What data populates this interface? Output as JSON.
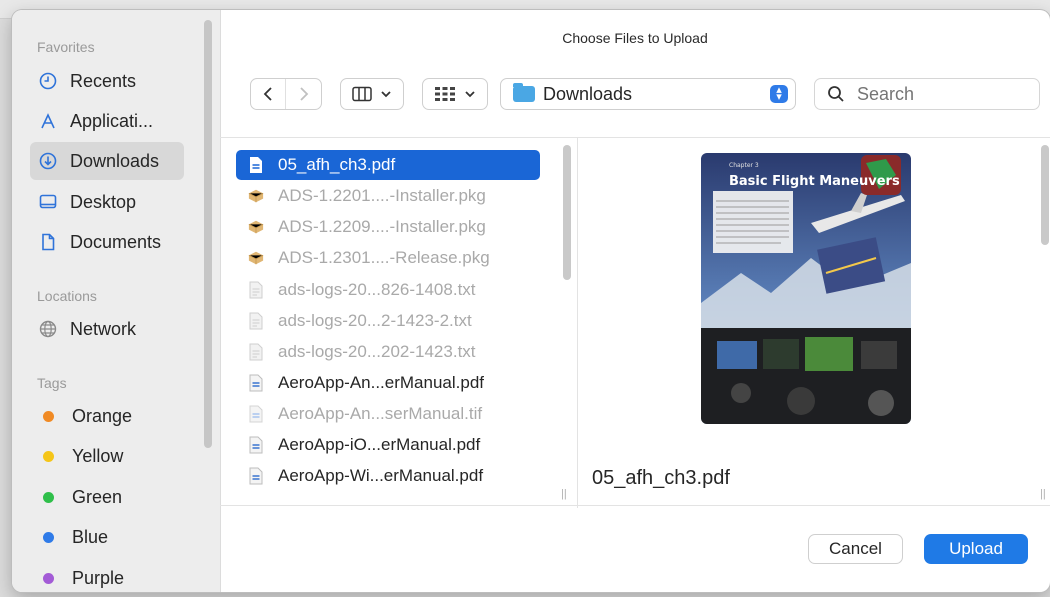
{
  "dialog": {
    "title": "Choose Files to Upload"
  },
  "sidebar": {
    "favorites_header": "Favorites",
    "favorites": [
      {
        "label": "Recents",
        "icon": "clock-icon"
      },
      {
        "label": "Applicati...",
        "icon": "applications-icon"
      },
      {
        "label": "Downloads",
        "icon": "download-icon",
        "active": true
      },
      {
        "label": "Desktop",
        "icon": "desktop-icon"
      },
      {
        "label": "Documents",
        "icon": "document-icon"
      }
    ],
    "locations_header": "Locations",
    "locations": [
      {
        "label": "Network",
        "icon": "globe-icon"
      }
    ],
    "tags_header": "Tags",
    "tags": [
      {
        "label": "Orange",
        "color": "#f08a24"
      },
      {
        "label": "Yellow",
        "color": "#f5c518"
      },
      {
        "label": "Green",
        "color": "#2fbf4a"
      },
      {
        "label": "Blue",
        "color": "#2f7be8"
      },
      {
        "label": "Purple",
        "color": "#a35bd6"
      }
    ]
  },
  "toolbar": {
    "location": "Downloads",
    "search_placeholder": "Search"
  },
  "files": [
    {
      "name": "05_afh_ch3.pdf",
      "type": "pdf",
      "selected": true,
      "dimmed": false
    },
    {
      "name": "ADS-1.2201....-Installer.pkg",
      "type": "pkg",
      "selected": false,
      "dimmed": true
    },
    {
      "name": "ADS-1.2209....-Installer.pkg",
      "type": "pkg",
      "selected": false,
      "dimmed": true
    },
    {
      "name": "ADS-1.2301....-Release.pkg",
      "type": "pkg",
      "selected": false,
      "dimmed": true
    },
    {
      "name": "ads-logs-20...826-1408.txt",
      "type": "txt",
      "selected": false,
      "dimmed": true
    },
    {
      "name": "ads-logs-20...2-1423-2.txt",
      "type": "txt",
      "selected": false,
      "dimmed": true
    },
    {
      "name": "ads-logs-20...202-1423.txt",
      "type": "txt",
      "selected": false,
      "dimmed": true
    },
    {
      "name": "AeroApp-An...erManual.pdf",
      "type": "pdf",
      "selected": false,
      "dimmed": false
    },
    {
      "name": "AeroApp-An...serManual.tif",
      "type": "tif",
      "selected": false,
      "dimmed": true
    },
    {
      "name": "AeroApp-iO...erManual.pdf",
      "type": "pdf",
      "selected": false,
      "dimmed": false
    },
    {
      "name": "AeroApp-Wi...erManual.pdf",
      "type": "pdf",
      "selected": false,
      "dimmed": false
    }
  ],
  "preview": {
    "filename": "05_afh_ch3.pdf",
    "cover_title": "Basic Flight Maneuvers",
    "cover_chapter": "Chapter 3"
  },
  "footer": {
    "cancel_label": "Cancel",
    "upload_label": "Upload"
  },
  "colors": {
    "accent": "#1f7ae6",
    "selection": "#1a66d6"
  }
}
